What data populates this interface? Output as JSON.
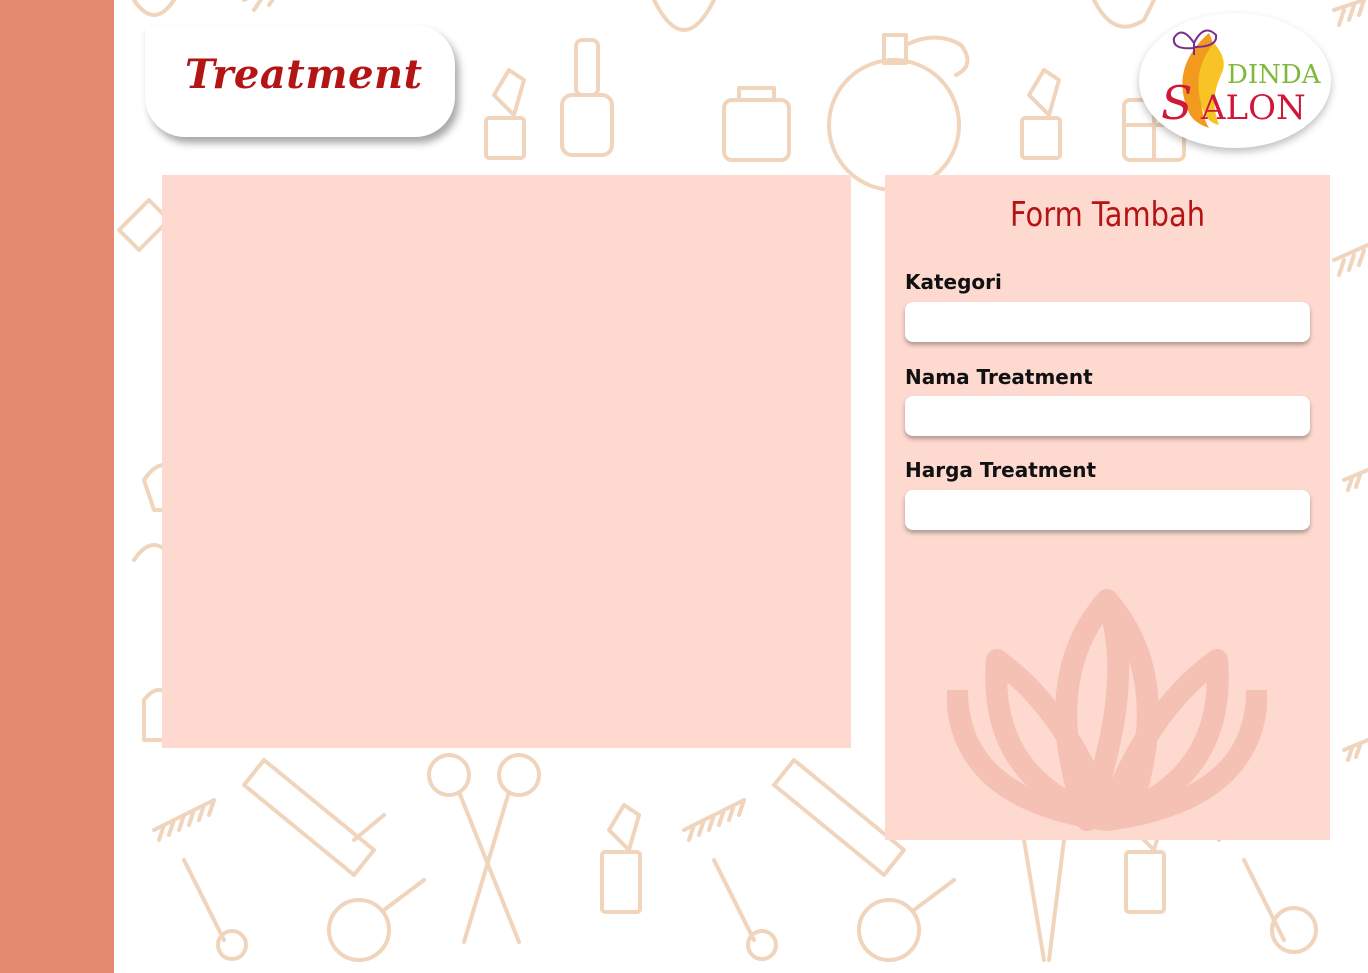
{
  "header": {
    "title": "Treatment"
  },
  "logo": {
    "line1": "DINDA",
    "line2": "ALON",
    "letter": "S"
  },
  "form": {
    "title": "Form Tambah",
    "fields": [
      {
        "label": "Kategori",
        "value": ""
      },
      {
        "label": "Nama Treatment",
        "value": ""
      },
      {
        "label": "Harga Treatment",
        "value": ""
      }
    ]
  },
  "colors": {
    "sidebar": "#e38a70",
    "panel": "#fdd9cf",
    "accent": "#b51414",
    "pattern_stroke": "#eecdb0"
  },
  "icons": [
    "lipstick-icon",
    "perfume-bottle-icon",
    "scissors-icon",
    "comb-icon",
    "hair-brush-icon",
    "mirror-icon",
    "lotus-icon"
  ]
}
